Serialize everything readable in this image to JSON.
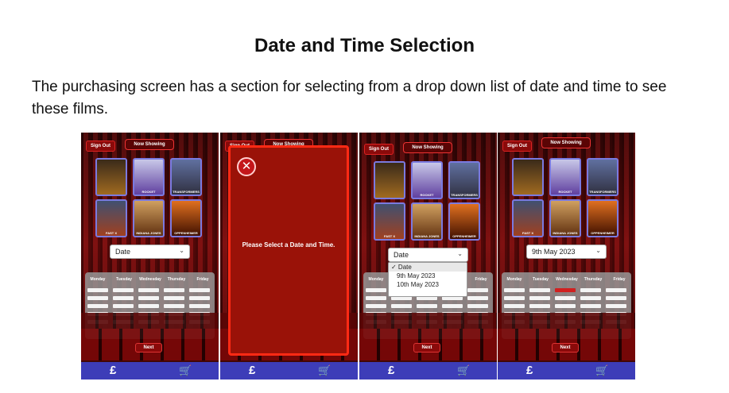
{
  "document": {
    "title": "Date and Time Selection",
    "paragraph": "The purchasing screen has a section for selecting from a drop down list of date and time to see these films."
  },
  "app": {
    "sign_out": "Sign Out",
    "now_showing": "Now Showing",
    "next": "Next",
    "date_placeholder": "Date",
    "selected_date": "9th May 2023",
    "days": [
      "Monday",
      "Tuesday",
      "Wednesday",
      "Thursday",
      "Friday"
    ],
    "modal_message": "Please Select a Date and Time.",
    "date_options": [
      "✓ Date",
      "9th May 2023",
      "10th May 2023"
    ],
    "posters": [
      "",
      "ROCKET",
      "TRANSFORMERS",
      "FAST X",
      "INDIANA JONES",
      "OPPENHEIMER"
    ],
    "icons": {
      "pound": "pound-icon",
      "cart": "cart-icon",
      "close": "close-icon",
      "chevron": "chevron-down-icon"
    },
    "colors": {
      "accent": "#d12020",
      "nav": "#3d3db8",
      "frame": "#8a0a0a"
    }
  }
}
